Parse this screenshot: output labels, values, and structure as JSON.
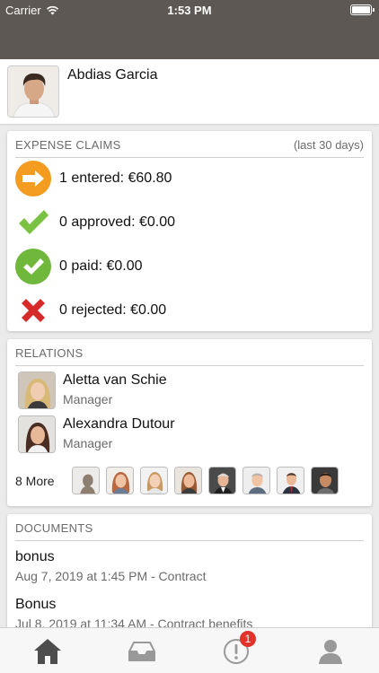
{
  "status_bar": {
    "carrier": "Carrier",
    "time": "1:53 PM"
  },
  "profile": {
    "name": "Abdias Garcia"
  },
  "expense_claims": {
    "title": "EXPENSE CLAIMS",
    "period": "(last 30 days)",
    "rows": [
      {
        "icon": "arrow-right-icon",
        "label": "1 entered: €60.80",
        "color": "#f39c1f"
      },
      {
        "icon": "checkmark-icon",
        "label": "0 approved: €0.00",
        "color": "#7bc142"
      },
      {
        "icon": "check-circle-icon",
        "label": "0 paid: €0.00",
        "color": "#6fb83c"
      },
      {
        "icon": "cross-icon",
        "label": "0 rejected: €0.00",
        "color": "#d62b2b"
      }
    ]
  },
  "relations": {
    "title": "RELATIONS",
    "people": [
      {
        "name": "Aletta van Schie",
        "role": "Manager"
      },
      {
        "name": "Alexandra Dutour",
        "role": "Manager"
      }
    ],
    "more_label": "8 More"
  },
  "documents": {
    "title": "DOCUMENTS",
    "items": [
      {
        "title": "bonus",
        "meta": "Aug 7, 2019 at 1:45 PM - Contract"
      },
      {
        "title": "Bonus",
        "meta": "Jul 8, 2019 at 11:34 AM - Contract benefits"
      }
    ]
  },
  "tab_bar": {
    "tabs": [
      {
        "icon": "home-icon"
      },
      {
        "icon": "inbox-icon"
      },
      {
        "icon": "alert-icon",
        "badge": "1"
      },
      {
        "icon": "person-icon"
      }
    ]
  },
  "colors": {
    "header": "#5d5853",
    "badge": "#e2322c"
  }
}
